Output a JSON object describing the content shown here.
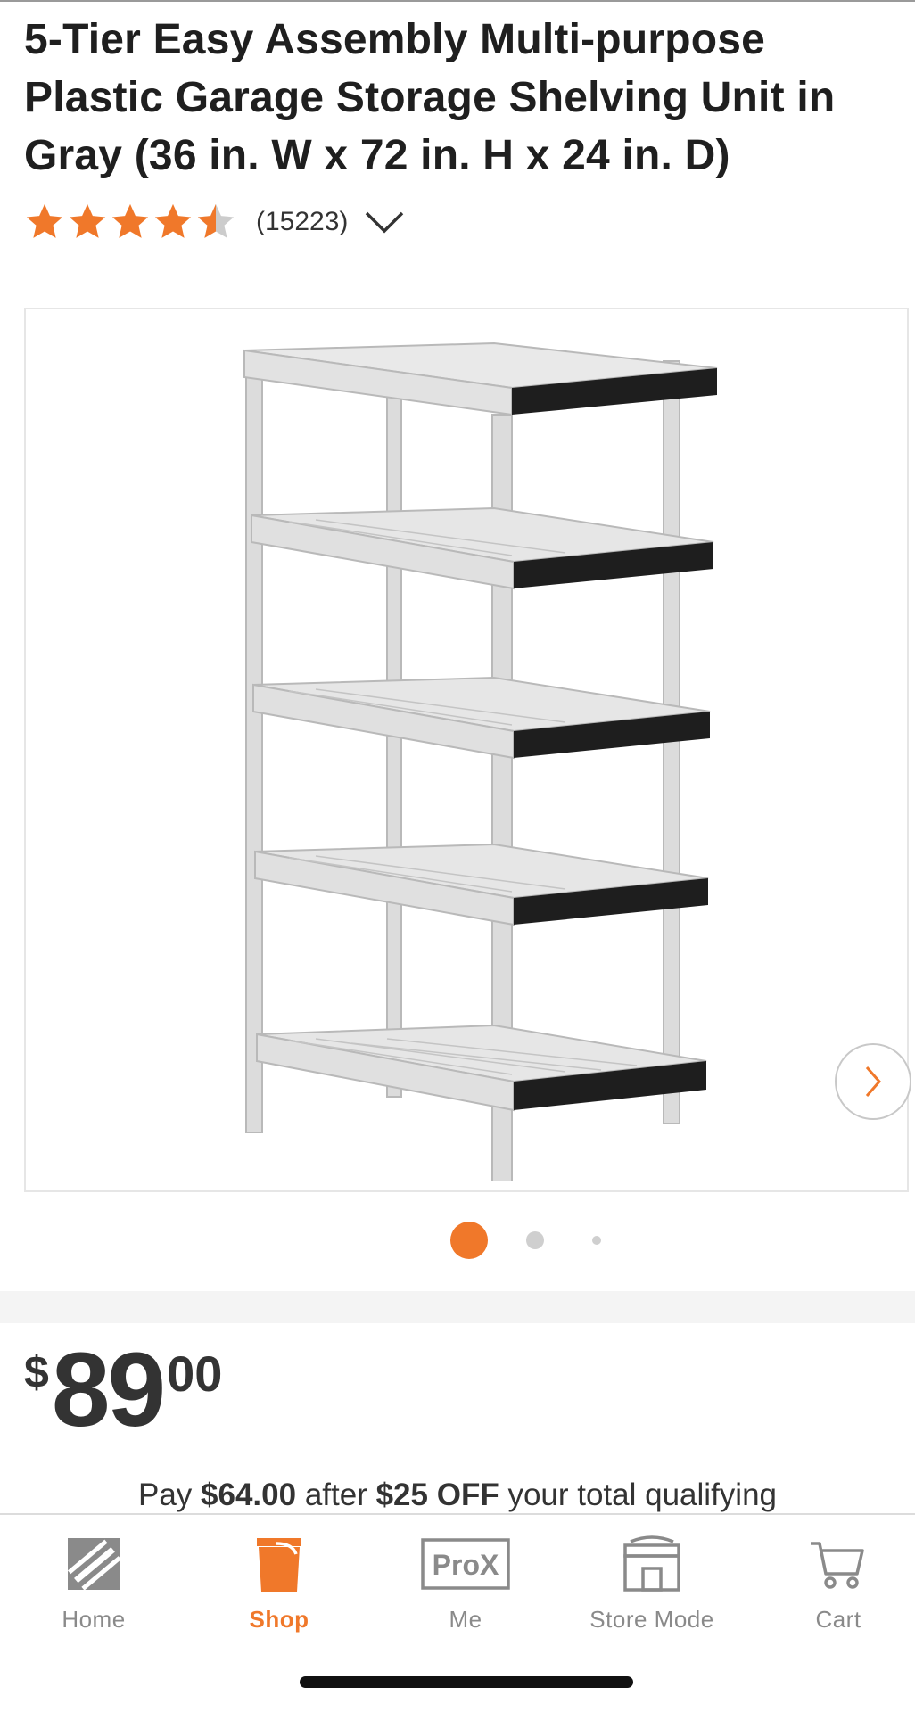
{
  "product": {
    "title": "5-Tier Easy Assembly Multi-purpose Plastic Garage Storage Shelving Unit in Gray (36 in. W x 72 in. H x 24 in. D)",
    "rating_value": 4.5,
    "rating_count": "(15223)",
    "image_name": "gray-5-tier-plastic-shelving-unit",
    "gallery_count": 3,
    "gallery_active_index": 0
  },
  "price": {
    "currency": "$",
    "dollars": "89",
    "cents": "00"
  },
  "promo": {
    "prefix": "Pay",
    "amount": "$64.00",
    "middle": "after",
    "discount": "$25 OFF",
    "suffix": "your total qualifying"
  },
  "tabbar": {
    "home": "Home",
    "shop": "Shop",
    "me": "Me",
    "me_icon_text": "ProX",
    "store_mode": "Store Mode",
    "cart": "Cart",
    "active": "Shop"
  },
  "colors": {
    "brand_orange": "#f0782a",
    "text_dark": "#1f1f1f",
    "muted": "#8a8a8a"
  },
  "icons": {
    "chevron": "chevron-down-icon",
    "next": "chevron-right-icon",
    "home": "home-depot-logo-icon",
    "shop": "bucket-icon",
    "me": "prox-badge-icon",
    "store": "storefront-icon",
    "cart": "cart-icon"
  }
}
